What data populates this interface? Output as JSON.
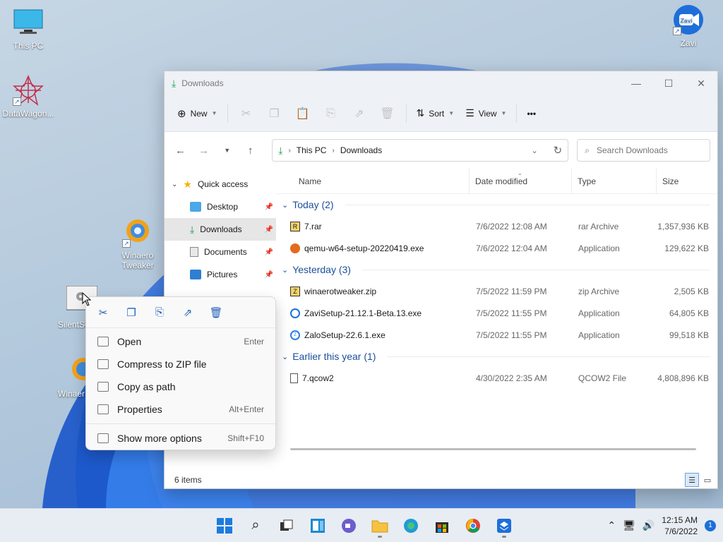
{
  "desktop": {
    "icons": [
      {
        "label": "This PC"
      },
      {
        "label": "DataWagon..."
      },
      {
        "label": "Zavi"
      },
      {
        "label": "Winaero Tweaker"
      },
      {
        "label": "SilentSe"
      },
      {
        "label": "Winaer"
      }
    ]
  },
  "window": {
    "title": "Downloads",
    "toolbar": {
      "new_label": "New",
      "sort_label": "Sort",
      "view_label": "View",
      "more_label": "•••"
    },
    "address": {
      "root": "This PC",
      "current": "Downloads"
    },
    "search": {
      "placeholder": "Search Downloads"
    },
    "nav": {
      "quick_access": "Quick access",
      "items": [
        {
          "label": "Desktop"
        },
        {
          "label": "Downloads"
        },
        {
          "label": "Documents"
        },
        {
          "label": "Pictures"
        }
      ]
    },
    "columns": {
      "name": "Name",
      "date": "Date modified",
      "type": "Type",
      "size": "Size"
    },
    "groups": [
      {
        "label": "Today (2)",
        "files": [
          {
            "name": "7.rar",
            "date": "7/6/2022 12:08 AM",
            "type": "rar Archive",
            "size": "1,357,936 KB"
          },
          {
            "name": "qemu-w64-setup-20220419.exe",
            "date": "7/6/2022 12:04 AM",
            "type": "Application",
            "size": "129,622 KB"
          }
        ]
      },
      {
        "label": "Yesterday (3)",
        "files": [
          {
            "name": "winaerotweaker.zip",
            "date": "7/5/2022 11:59 PM",
            "type": "zip Archive",
            "size": "2,505 KB"
          },
          {
            "name": "ZaviSetup-21.12.1-Beta.13.exe",
            "date": "7/5/2022 11:55 PM",
            "type": "Application",
            "size": "64,805 KB"
          },
          {
            "name": "ZaloSetup-22.6.1.exe",
            "date": "7/5/2022 11:55 PM",
            "type": "Application",
            "size": "99,518 KB"
          }
        ]
      },
      {
        "label": "Earlier this year (1)",
        "files": [
          {
            "name": "7.qcow2",
            "date": "4/30/2022 2:35 AM",
            "type": "QCOW2 File",
            "size": "4,808,896 KB"
          }
        ]
      }
    ],
    "status": "6 items"
  },
  "context_menu": {
    "items": [
      {
        "label": "Open",
        "shortcut": "Enter"
      },
      {
        "label": "Compress to ZIP file",
        "shortcut": ""
      },
      {
        "label": "Copy as path",
        "shortcut": ""
      },
      {
        "label": "Properties",
        "shortcut": "Alt+Enter"
      },
      {
        "label": "Show more options",
        "shortcut": "Shift+F10"
      }
    ]
  },
  "taskbar": {
    "time": "12:15 AM",
    "date": "7/6/2022",
    "notification_count": "1"
  },
  "colors": {
    "accent": "#1e6fd9",
    "group_header": "#1d4f9a",
    "download_green": "#1f9e55"
  }
}
